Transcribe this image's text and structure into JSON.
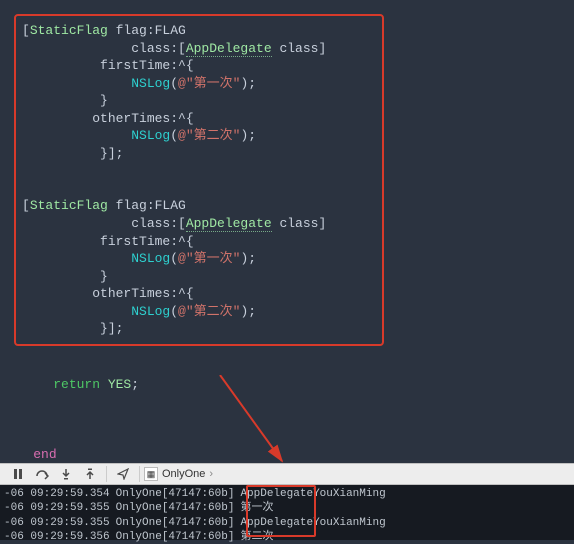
{
  "code_block1": {
    "l1_pre": "[",
    "l1_type": "StaticFlag",
    "l1_rest": " flag:FLAG",
    "l2_pre": "              class:[",
    "l2_type": "AppDelegate",
    "l2_rest": " class]",
    "l3_pre": "          firstTime:^{",
    "l4_pre": "              ",
    "l4_fn": "NSLog",
    "l4_open": "(",
    "l4_at": "@",
    "l4_str": "\"第一次\"",
    "l4_close": ");",
    "l5_pre": "          }",
    "l6_pre": "         otherTimes:^{",
    "l7_pre": "              ",
    "l7_fn": "NSLog",
    "l7_open": "(",
    "l7_at": "@",
    "l7_str": "\"第二次\"",
    "l7_close": ");",
    "l8_pre": "          }];"
  },
  "code_block2": {
    "l1_pre": "[",
    "l1_type": "StaticFlag",
    "l1_rest": " flag:FLAG",
    "l2_pre": "              class:[",
    "l2_type": "AppDelegate",
    "l2_rest": " class]",
    "l3_pre": "          firstTime:^{",
    "l4_pre": "              ",
    "l4_fn": "NSLog",
    "l4_open": "(",
    "l4_at": "@",
    "l4_str": "\"第一次\"",
    "l4_close": ");",
    "l5_pre": "          }",
    "l6_pre": "         otherTimes:^{",
    "l7_pre": "              ",
    "l7_fn": "NSLog",
    "l7_open": "(",
    "l7_at": "@",
    "l7_str": "\"第二次\"",
    "l7_close": ");",
    "l8_pre": "          }];"
  },
  "return_line": {
    "kw": "return",
    "val": " YES",
    "semi": ";"
  },
  "end_kw": "end",
  "toolbar": {
    "pause_icon": "pause-icon",
    "step_over_icon": "step-over-icon",
    "step_in_icon": "step-in-icon",
    "step_out_icon": "step-out-icon",
    "location_icon": "location-icon",
    "scheme_label": "OnlyOne"
  },
  "console": {
    "rows": [
      {
        "ts": "-06 09:29:59.354",
        "proc": "OnlyOne[47147:60b]",
        "msg": "AppDelegateYouXianMing"
      },
      {
        "ts": "-06 09:29:59.355",
        "proc": "OnlyOne[47147:60b]",
        "msg": "第一次"
      },
      {
        "ts": "-06 09:29:59.355",
        "proc": "OnlyOne[47147:60b]",
        "msg": "AppDelegateYouXianMing"
      },
      {
        "ts": "-06 09:29:59.356",
        "proc": "OnlyOne[47147:60b]",
        "msg": "第二次"
      }
    ]
  },
  "colors": {
    "red_box": "#d83a2a",
    "bg": "#2b3340"
  }
}
